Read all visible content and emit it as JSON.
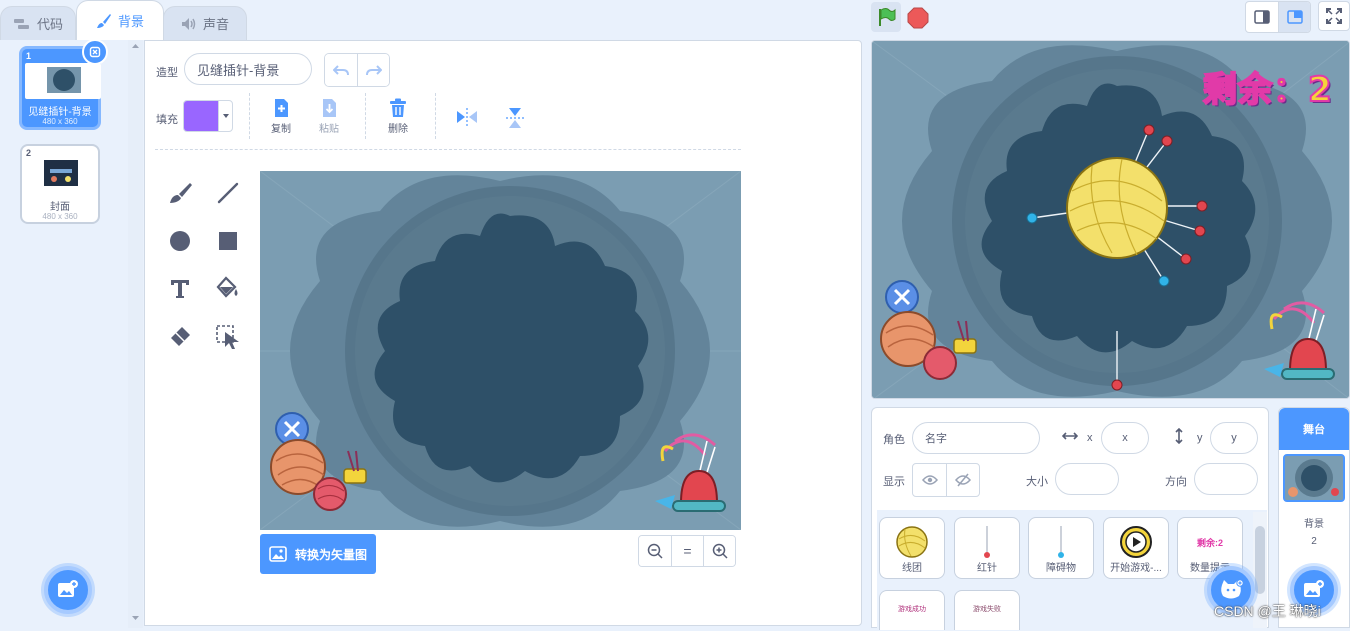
{
  "tabs": [
    {
      "label": "代码",
      "icon": "code-icon"
    },
    {
      "label": "背景",
      "icon": "brush-icon"
    },
    {
      "label": "声音",
      "icon": "speaker-icon"
    }
  ],
  "costumes": [
    {
      "number": "1",
      "name": "见缝插针-背景",
      "size": "480 x 360"
    },
    {
      "number": "2",
      "name": "封面",
      "size": "480 x 360"
    }
  ],
  "editor": {
    "costume_label": "造型",
    "costume_name": "见缝插针-背景",
    "fill_label": "填充",
    "fill_color": "#9966ff",
    "copy_label": "复制",
    "paste_label": "粘贴",
    "delete_label": "删除",
    "convert_label": "转换为矢量图",
    "zoom_reset": "="
  },
  "stage": {
    "remaining_text": "剩余：2"
  },
  "sprite_info": {
    "sprite_label": "角色",
    "name_placeholder": "名字",
    "x_label": "x",
    "x_placeholder": "x",
    "y_label": "y",
    "y_placeholder": "y",
    "show_label": "显示",
    "size_label": "大小",
    "direction_label": "方向"
  },
  "sprites": [
    {
      "name": "线团"
    },
    {
      "name": "红针"
    },
    {
      "name": "障碍物"
    },
    {
      "name": "开始游戏-..."
    },
    {
      "name": "数量提示"
    },
    {
      "name": ""
    },
    {
      "name": ""
    }
  ],
  "sprite_thumb_texts": {
    "count_hint": "剩余:2",
    "row2_a": "游戏成功",
    "row2_b": "游戏失败"
  },
  "stage_selector": {
    "title": "舞台",
    "backdrops_label": "背景",
    "backdrops_count": "2"
  },
  "watermark": "CSDN @王 琳晓i",
  "colors": {
    "accent": "#4c97ff",
    "stage_bg": "#7595ab",
    "dark_flower": "#2e5068",
    "yarn_yellow": "#f3e06b",
    "pin_red": "#e2464f",
    "pin_blue": "#30b3e8"
  }
}
